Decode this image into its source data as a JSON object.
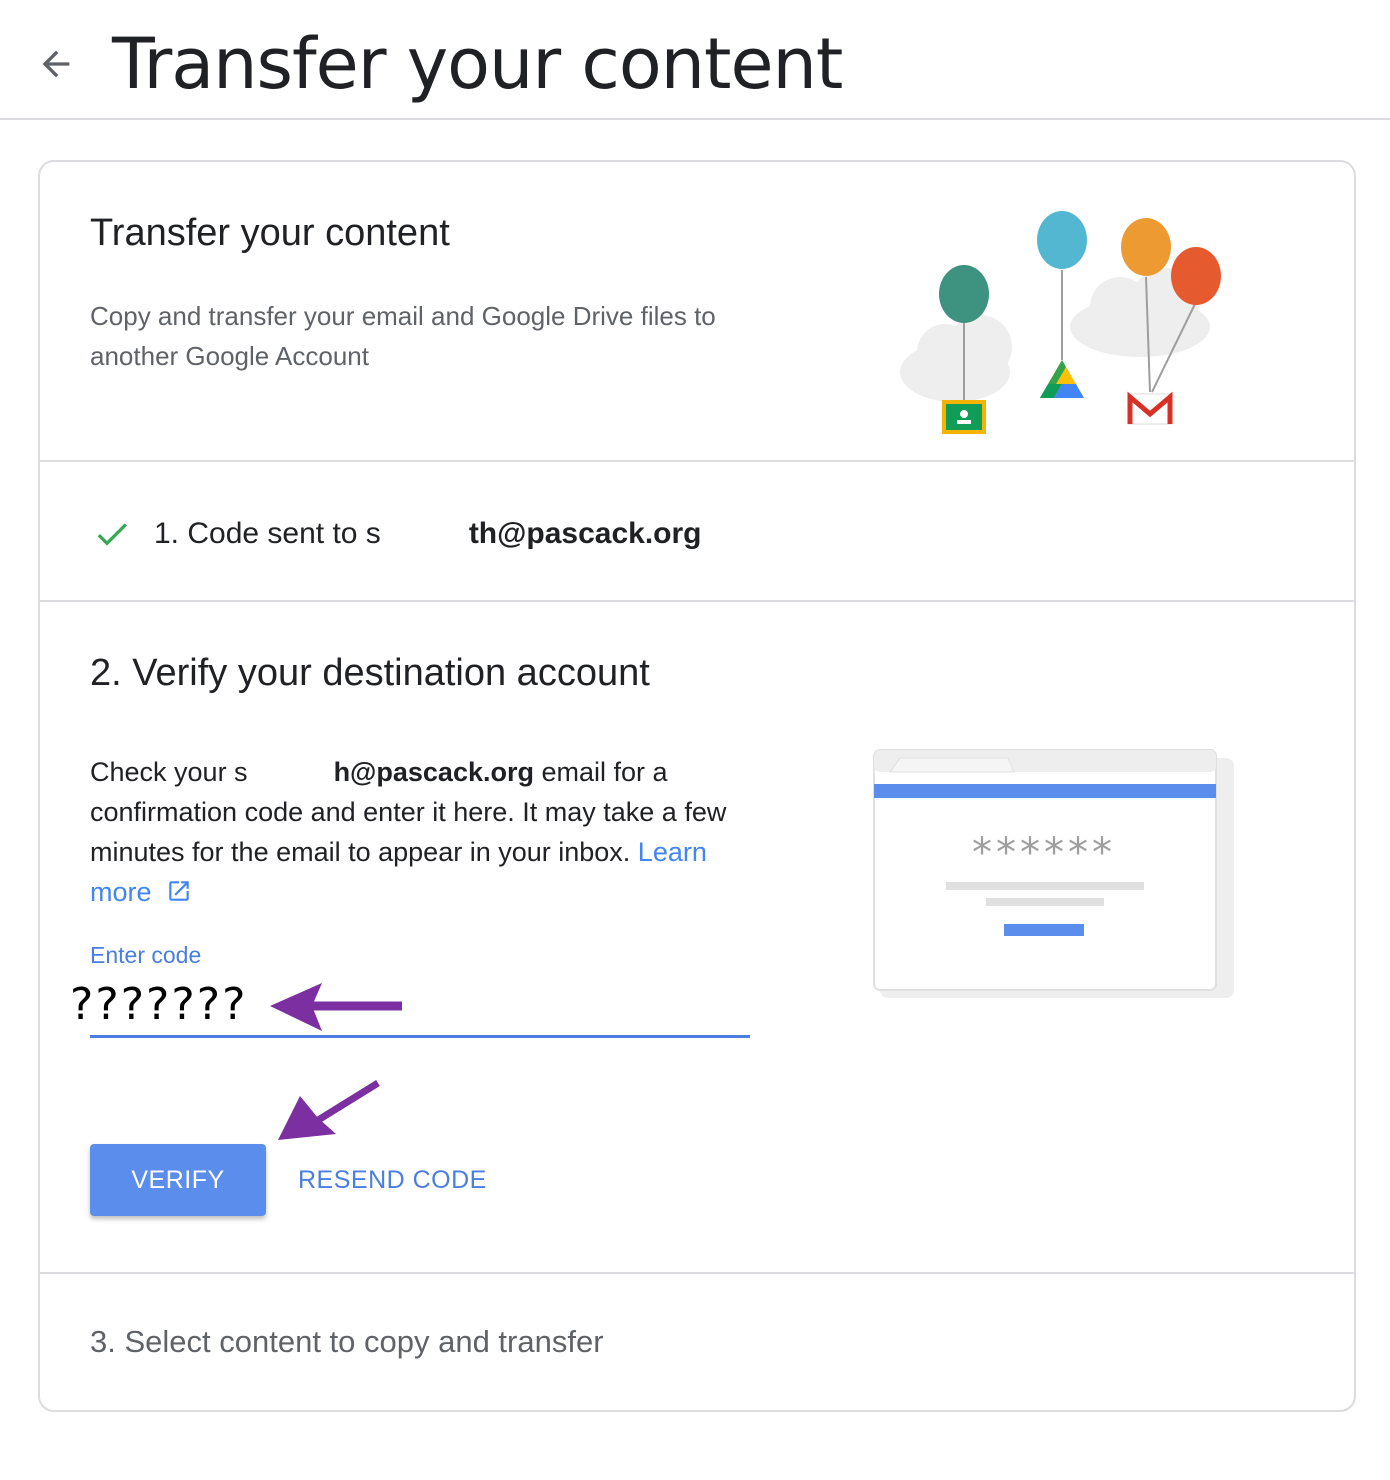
{
  "header": {
    "back_icon": "arrow-back-icon",
    "title": "Transfer your content"
  },
  "intro": {
    "title": "Transfer your content",
    "description": "Copy and transfer your email and Google Drive files to another Google Account"
  },
  "step1": {
    "prefix": "1. Code sent to s",
    "email_visible": "th@pascack.org",
    "status_icon": "check-icon"
  },
  "step2": {
    "title": "2. Verify your destination account",
    "desc_prefix": "Check your s",
    "email_visible": "h@pascack.org",
    "desc_suffix": " email for a confirmation code and enter it here. It may take a few minutes for the email to appear in your inbox. ",
    "learn_more": "Learn more",
    "code_label": "Enter code",
    "code_value": "???????",
    "verify_label": "VERIFY",
    "resend_label": "RESEND CODE",
    "illustration_mask": "******"
  },
  "step3": {
    "title": "3. Select content to copy and transfer"
  },
  "colors": {
    "accent": "#4285f4",
    "button": "#5b8ded",
    "check": "#34a853",
    "annotation_arrow": "#7b2fa0"
  }
}
